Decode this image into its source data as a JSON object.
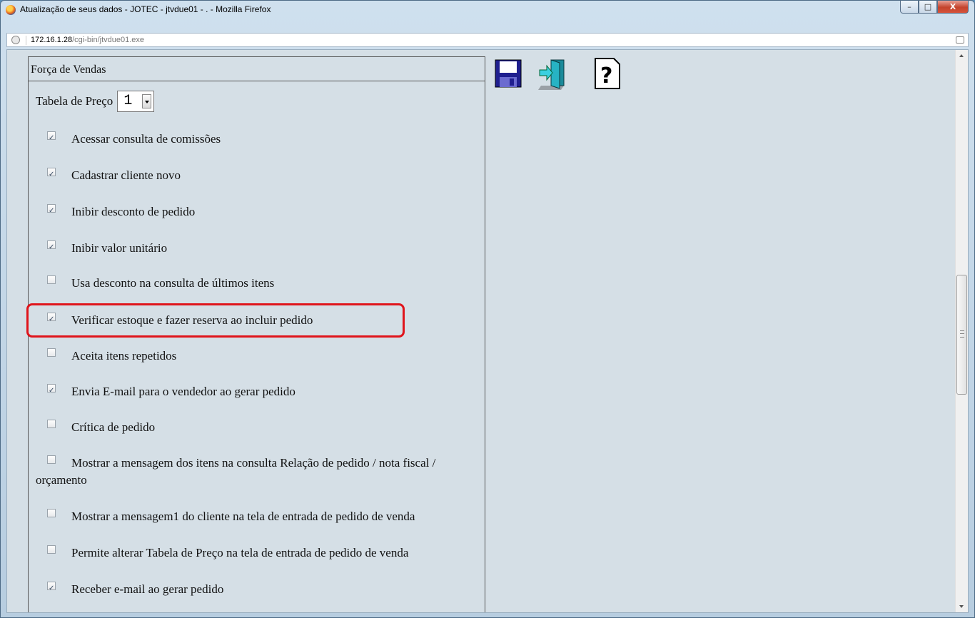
{
  "window": {
    "title": "Atualização de seus dados - JOTEC - jtvdue01 - . - Mozilla Firefox",
    "controls": {
      "minimize": "–",
      "maximize": "□",
      "close": "X"
    }
  },
  "address_bar": {
    "host": "172.16.1.28",
    "path": "/cgi-bin/jtvdue01.exe"
  },
  "panel": {
    "title": "Força de Vendas",
    "price_table": {
      "label": "Tabela de Preço",
      "selected": "1"
    },
    "options": [
      {
        "label": "Acessar consulta de comissões",
        "checked": true
      },
      {
        "label": "Cadastrar cliente novo",
        "checked": true
      },
      {
        "label": "Inibir desconto de pedido",
        "checked": true
      },
      {
        "label": "Inibir valor unitário",
        "checked": true
      },
      {
        "label": "Usa desconto na consulta de últimos itens",
        "checked": false
      },
      {
        "label": "Verificar estoque e fazer reserva ao incluir pedido",
        "checked": true,
        "highlighted": true
      },
      {
        "label": "Aceita itens repetidos",
        "checked": false
      },
      {
        "label": "Envia E-mail para o vendedor ao gerar pedido",
        "checked": true
      },
      {
        "label": "Crítica de pedido",
        "checked": false
      },
      {
        "label": "Mostrar a mensagem dos itens na consulta Relação de pedido / nota fiscal / orçamento",
        "checked": false
      },
      {
        "label": "Mostrar a mensagem1 do cliente na tela de entrada de pedido de venda",
        "checked": false
      },
      {
        "label": "Permite alterar Tabela de Preço na tela de entrada de pedido de venda",
        "checked": false
      },
      {
        "label": "Receber e-mail ao gerar pedido",
        "checked": true
      }
    ]
  },
  "toolbar": {
    "icons": [
      "save-icon",
      "exit-door-icon",
      "help-icon"
    ]
  },
  "colors": {
    "page_background": "#d5dfe6",
    "highlight_border": "#e0141b"
  }
}
